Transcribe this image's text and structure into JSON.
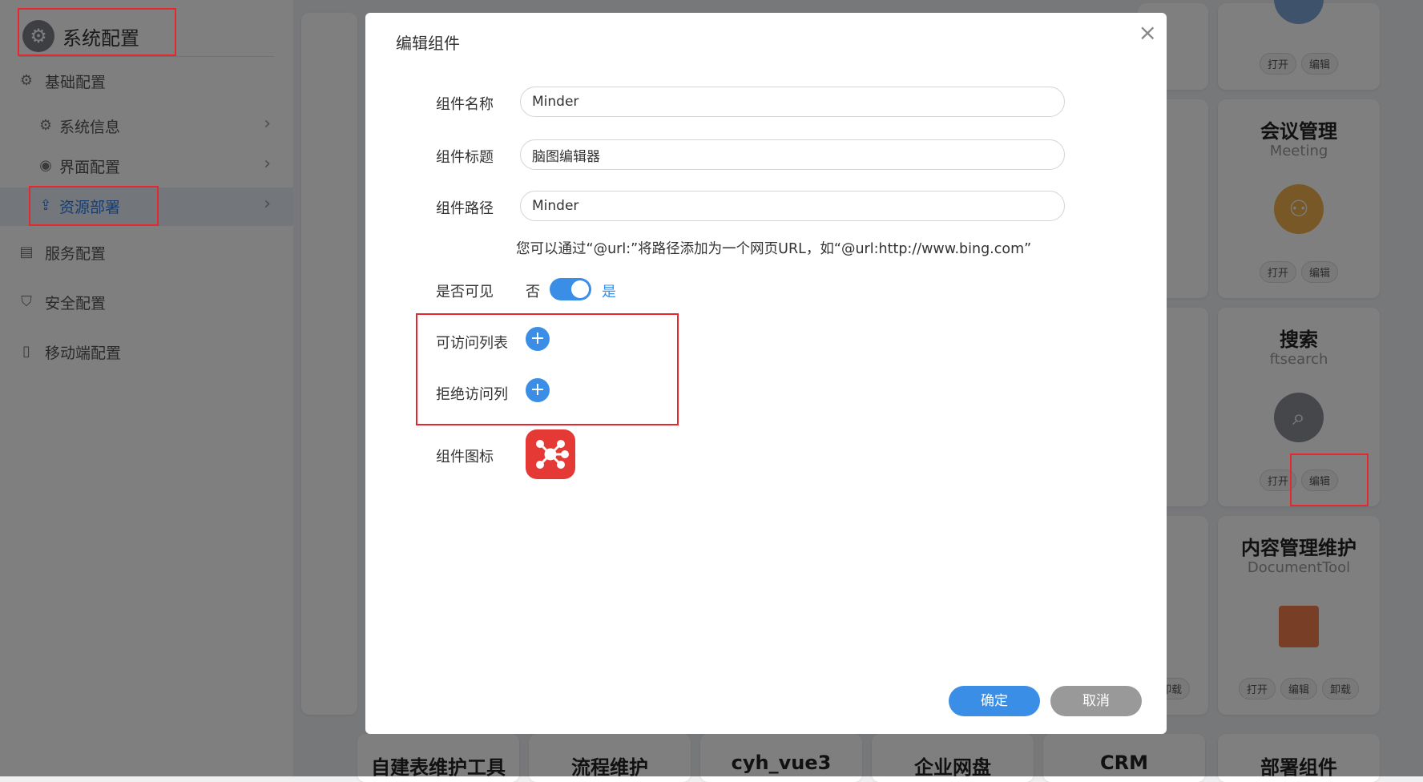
{
  "sidebar": {
    "title": "系统配置",
    "groups": [
      {
        "label": "基础配置",
        "icon": "gear-icon"
      },
      {
        "label": "服务配置",
        "icon": "server-icon"
      },
      {
        "label": "安全配置",
        "icon": "shield-icon"
      },
      {
        "label": "移动端配置",
        "icon": "mobile-icon"
      }
    ],
    "sub_items": [
      {
        "label": "系统信息",
        "icon": "gear-icon"
      },
      {
        "label": "界面配置",
        "icon": "palette-icon"
      },
      {
        "label": "资源部署",
        "icon": "upload-icon"
      }
    ]
  },
  "cards": {
    "top_right": {
      "open": "打开",
      "edit": "编辑"
    },
    "meeting": {
      "title": "会议管理",
      "subtitle": "Meeting",
      "open": "打开",
      "edit": "编辑"
    },
    "search": {
      "title": "搜索",
      "subtitle": "ftsearch",
      "open": "打开",
      "edit": "编辑"
    },
    "content": {
      "title": "内容管理维护",
      "subtitle": "DocumentTool",
      "open": "打开",
      "edit": "编辑",
      "uninstall": "卸载"
    },
    "partial_uninstall": "卸载",
    "bottom_row": [
      "自建表维护工具",
      "流程维护",
      "cyh_vue3",
      "企业网盘",
      "CRM",
      "部署组件"
    ]
  },
  "dialog": {
    "title": "编辑组件",
    "name_label": "组件名称",
    "name_value": "Minder",
    "title_label": "组件标题",
    "title_value": "脑图编辑器",
    "path_label": "组件路径",
    "path_value": "Minder",
    "hint": "您可以通过“@url:”将路径添加为一个网页URL，如“@url:http://www.bing.com”",
    "visible_label": "是否可见",
    "visible_no": "否",
    "visible_yes": "是",
    "allow_label": "可访问列表",
    "deny_label": "拒绝访问列",
    "icon_label": "组件图标",
    "ok_label": "确定",
    "cancel_label": "取消",
    "close_symbol": "×"
  },
  "colors": {
    "accent": "#3a8ee6",
    "highlight_box": "#e8262d",
    "meeting_icon": "#f0b14c",
    "search_icon": "#8a8f96",
    "component_icon": "#e53935"
  }
}
